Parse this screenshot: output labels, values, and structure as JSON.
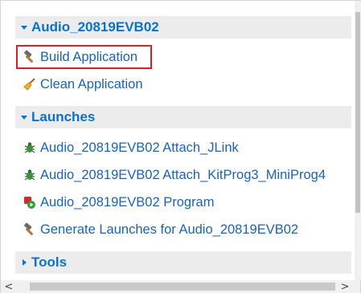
{
  "sections": [
    {
      "title": "Audio_20819EVB02",
      "expanded": true,
      "items": [
        {
          "label": "Build Application",
          "icon": "hammer-icon",
          "highlighted": true
        },
        {
          "label": "Clean Application",
          "icon": "broom-icon"
        }
      ]
    },
    {
      "title": "Launches",
      "expanded": true,
      "items": [
        {
          "label": "Audio_20819EVB02 Attach_JLink",
          "icon": "debug-bug-icon"
        },
        {
          "label": "Audio_20819EVB02 Attach_KitProg3_MiniProg4",
          "icon": "debug-bug-icon"
        },
        {
          "label": "Audio_20819EVB02 Program",
          "icon": "program-icon"
        },
        {
          "label": "Generate Launches for Audio_20819EVB02",
          "icon": "hammer-icon"
        }
      ]
    },
    {
      "title": "Tools",
      "expanded": false,
      "items": []
    }
  ],
  "colors": {
    "link": "#1a63b5",
    "section_title": "#0a73c9",
    "section_bg": "#ececec",
    "highlight_border": "#d3212a"
  },
  "scrollbars": {
    "left_arrow": "<",
    "right_arrow": ">"
  }
}
